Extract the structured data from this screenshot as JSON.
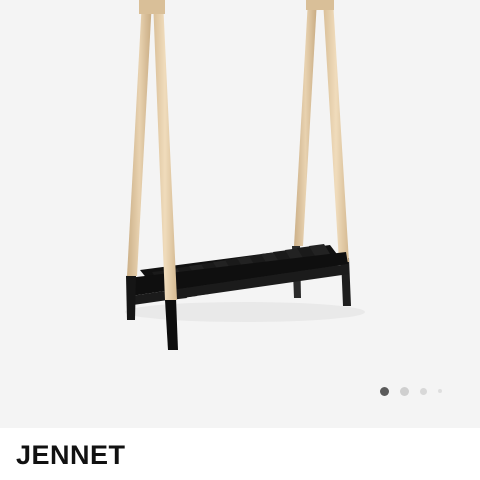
{
  "product": {
    "name": "JENNET",
    "image_icon": "clothes-rack-photo"
  },
  "gallery": {
    "page_count": 4,
    "active_page": 1
  },
  "colors": {
    "gallery_background": "#f4f4f4",
    "wood": "#e6cfae",
    "frame": "#1c1c1c",
    "dot_active": "#5a5a5a",
    "dot_inactive": "#cfcfcf",
    "title": "#111111"
  }
}
